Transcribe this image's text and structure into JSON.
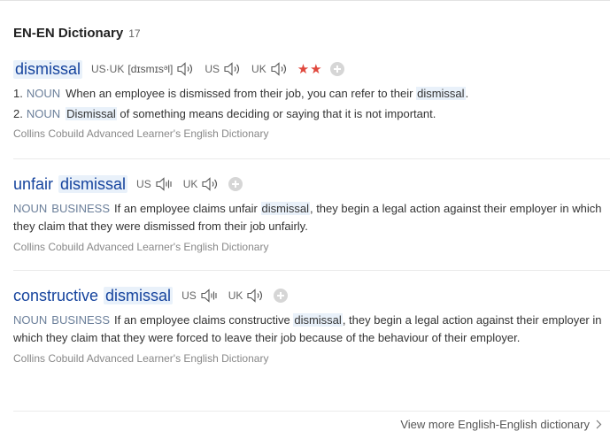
{
  "header": {
    "title": "EN-EN Dictionary",
    "count": "17"
  },
  "entries": [
    {
      "headword": "dismissal",
      "pron_us_uk_label": "US·UK",
      "phonetic": "[dɪsmɪsᵊl]",
      "us_label": "US",
      "uk_label": "UK",
      "stars": "★★",
      "senses": [
        {
          "num": "1.",
          "pos": "NOUN",
          "text_before": "When an employee is dismissed from their job, you can refer to their ",
          "highlight": "dismissal",
          "text_after": "."
        },
        {
          "num": "2.",
          "pos": "NOUN",
          "text_before": "",
          "highlight": "Dismissal",
          "text_after": " of something means deciding or saying that it is not important."
        }
      ],
      "source": "Collins Cobuild Advanced Learner's English Dictionary"
    },
    {
      "headword_pre": "unfair",
      "headword_hl": "dismissal",
      "us_label": "US",
      "uk_label": "UK",
      "pos": "NOUN",
      "category": "BUSINESS",
      "text_before": "If an employee claims unfair ",
      "highlight": "dismissal",
      "text_after": ", they begin a legal action against their employer in which they claim that they were dismissed from their job unfairly.",
      "source": "Collins Cobuild Advanced Learner's English Dictionary"
    },
    {
      "headword_pre": "constructive",
      "headword_hl": "dismissal",
      "us_label": "US",
      "uk_label": "UK",
      "pos": "NOUN",
      "category": "BUSINESS",
      "text_before": "If an employee claims constructive ",
      "highlight": "dismissal",
      "text_after": ", they begin a legal action against their employer in which they claim that they were forced to leave their job because of the behaviour of their employer.",
      "source": "Collins Cobuild Advanced Learner's English Dictionary"
    }
  ],
  "footer": {
    "more_link": "View more English-English dictionary"
  },
  "icons": {
    "speaker": "speaker-icon",
    "add": "plus-circle-icon",
    "chevron": "chevron-right-icon"
  },
  "colors": {
    "headword": "#15439d",
    "highlight_bg": "#e9f1fa",
    "stars": "#e0483d",
    "pos": "#6b7f9a"
  }
}
